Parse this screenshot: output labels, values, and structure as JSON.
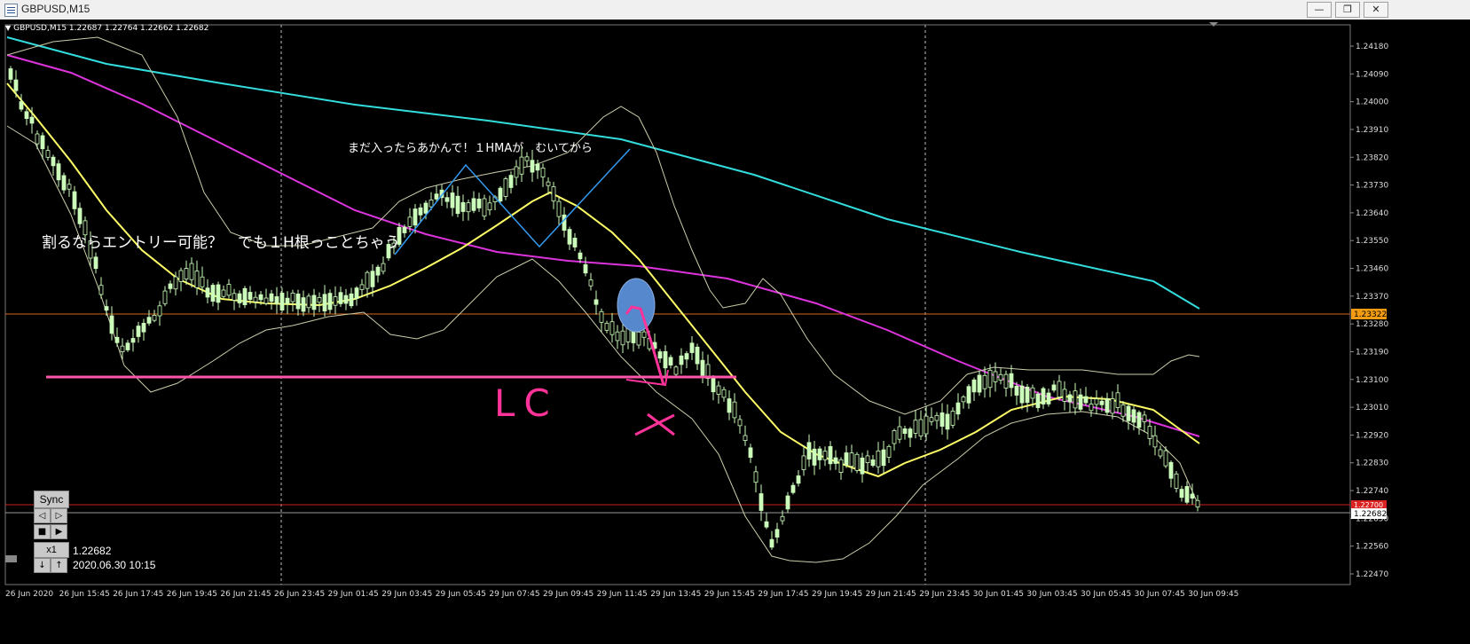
{
  "window": {
    "title": "GBPUSD,M15",
    "minimize": "—",
    "restore": "❐",
    "close": "✕"
  },
  "chart": {
    "header": "GBPUSD,M15  1.22687 1.22764 1.22662 1.22682",
    "price_axis": [
      "1.24180",
      "1.24090",
      "1.24000",
      "1.23910",
      "1.23820",
      "1.23730",
      "1.23640",
      "1.23550",
      "1.23460",
      "1.23370",
      "1.23280",
      "1.23190",
      "1.23100",
      "1.23010",
      "1.22920",
      "1.22830",
      "1.22740",
      "1.22650",
      "1.22560",
      "1.22470"
    ],
    "time_axis": [
      "26 Jun 2020",
      "26 Jun 15:45",
      "26 Jun 17:45",
      "26 Jun 19:45",
      "26 Jun 21:45",
      "26 Jun 23:45",
      "29 Jun 01:45",
      "29 Jun 03:45",
      "29 Jun 05:45",
      "29 Jun 07:45",
      "29 Jun 09:45",
      "29 Jun 11:45",
      "29 Jun 13:45",
      "29 Jun 15:45",
      "29 Jun 17:45",
      "29 Jun 19:45",
      "29 Jun 21:45",
      "29 Jun 23:45",
      "30 Jun 01:45",
      "30 Jun 03:45",
      "30 Jun 05:45",
      "30 Jun 07:45",
      "30 Jun 09:45"
    ],
    "tags": {
      "orange": "1.23322",
      "red": "1.22700",
      "white": "1.22682"
    },
    "colors": {
      "background": "#000000",
      "candle_up": "#ccffbb",
      "candle_down": "#ccffbb",
      "ema_yellow": "#ffff66",
      "ma_magenta": "#dd33dd",
      "ma_cyan": "#33dddd",
      "bands": "#ddddaa",
      "pink": "#ff55aa",
      "orange_line": "#d2691e",
      "red_line": "#cc2222"
    }
  },
  "annotations": {
    "note_top": "まだ入ったらあかんで！１HMAが　むいてから",
    "note_left": "割るならエントリー可能？　でも１H根っことちゃう",
    "handwriting": "LC"
  },
  "replay": {
    "sync": "Sync",
    "step_back": "◁",
    "step_fwd": "▷",
    "stop": "■",
    "play": "▶",
    "speed": "x1",
    "down": "↓",
    "up": "↑",
    "price": "1.22682",
    "datetime": "2020.06.30 10:15"
  }
}
